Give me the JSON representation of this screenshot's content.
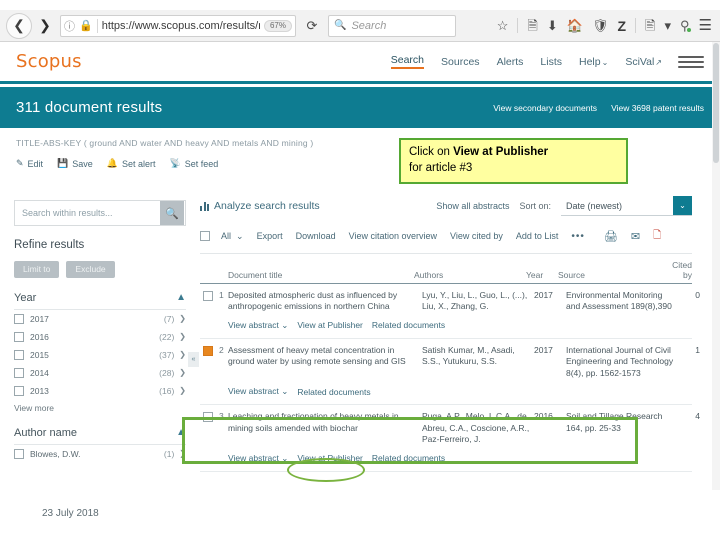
{
  "browser": {
    "back_icon": "back-arrow-icon",
    "forward_icon": "forward-arrow-icon",
    "info_icon": "ⓘ",
    "lock_icon": "🔒",
    "url": "https://www.scopus.com/results/r",
    "zoom_level": "67%",
    "reload_icon": "⟳",
    "search_placeholder": "Search",
    "search_icon": "🔍",
    "toolbar_icons": [
      "bookmark-star",
      "reader-list",
      "downloads",
      "home",
      "shield",
      "zotero-Z",
      "page-capture",
      "dropdown-caret",
      "tracker",
      "menu"
    ]
  },
  "scopus": {
    "logo": "Scopus",
    "nav": [
      {
        "label": "Search",
        "active": true
      },
      {
        "label": "Sources",
        "active": false
      },
      {
        "label": "Alerts",
        "active": false
      },
      {
        "label": "Lists",
        "active": false
      },
      {
        "label": "Help",
        "caret": "⌄",
        "active": false
      },
      {
        "label": "SciVal",
        "caret": "↗",
        "active": false
      }
    ],
    "banner": {
      "results_title": "311 document results",
      "secondary_link": "View secondary documents",
      "patent_link": "View 3698 patent results",
      "bg_color": "#0e7c91"
    },
    "query": {
      "text": "TITLE-ABS-KEY ( ground  AND water  AND  heavy  AND metals  AND mining )",
      "actions": [
        {
          "label": "Edit",
          "icon": "pencil-icon"
        },
        {
          "label": "Save",
          "icon": "disk-icon"
        },
        {
          "label": "Set alert",
          "icon": "bell-icon"
        },
        {
          "label": "Set feed",
          "icon": "rss-icon"
        }
      ]
    }
  },
  "callout": {
    "line1_prefix": "Click on ",
    "line1_bold": "View at Publisher",
    "line2": "for article #3",
    "bg_color": "#ffffa0",
    "border_color": "#55a833"
  },
  "sidebar": {
    "search_within_placeholder": "Search within results...",
    "search_icon": "🔍",
    "refine_title": "Refine results",
    "limit_button": "Limit to",
    "exclude_button": "Exclude",
    "collapse_icon": "«",
    "facets": [
      {
        "title": "Year",
        "chevron": "⌃",
        "rows": [
          {
            "label": "2017",
            "count": "(7)"
          },
          {
            "label": "2016",
            "count": "(22)"
          },
          {
            "label": "2015",
            "count": "(37)"
          },
          {
            "label": "2014",
            "count": "(28)"
          },
          {
            "label": "2013",
            "count": "(16)"
          }
        ],
        "view_more": "View more"
      },
      {
        "title": "Author name",
        "chevron": "⌃",
        "rows": [
          {
            "label": "Blowes, D.W.",
            "count": "(1)"
          }
        ],
        "view_more": ""
      }
    ]
  },
  "results": {
    "analyze_label": "Analyze search results",
    "show_abstracts": "Show all abstracts",
    "sort_label": "Sort on:",
    "sort_value": "Date (newest)",
    "sort_caret": "⌄",
    "actions": {
      "all_label": "All",
      "all_caret": "⌄",
      "export": "Export",
      "download": "Download",
      "citation_overview": "View citation overview",
      "cited_by": "View cited by",
      "add_to_list": "Add to List",
      "more": "•••",
      "print_icon": "🖨",
      "mail_icon": "✉",
      "pdf_icon": "PDF"
    },
    "columns": {
      "title": "Document title",
      "authors": "Authors",
      "year": "Year",
      "source": "Source",
      "cited_by": "Cited by"
    },
    "rows": [
      {
        "index": "1",
        "checked": false,
        "title": "Deposited atmospheric dust as influenced by anthropogenic emissions in northern China",
        "authors": "Lyu, Y., Liu, L., Guo, L., (...), Liu, X., Zhang, G.",
        "year": "2017",
        "source": "Environmental Monitoring and Assessment 189(8),390",
        "cited_by": "0",
        "links": [
          "View abstract ⌄",
          "View at Publisher",
          "Related documents"
        ]
      },
      {
        "index": "2",
        "checked": true,
        "title": "Assessment of heavy metal concentration in ground water by using remote sensing and GIS",
        "authors": "Satish Kumar, M., Asadi, S.S., Yutukuru, S.S.",
        "year": "2017",
        "source": "International Journal of Civil Engineering and Technology 8(4), pp. 1562-1573",
        "cited_by": "1",
        "links": [
          "View abstract ⌄",
          "Related documents"
        ]
      },
      {
        "index": "3",
        "checked": false,
        "title": "Leaching and fractionation of heavy metals in mining soils amended with biochar",
        "authors": "Puga, A.P., Melo, L.C.A., de Abreu, C.A., Coscione, A.R., Paz-Ferreiro, J.",
        "year": "2016",
        "source": "Soil and Tillage Research 164, pp. 25-33",
        "cited_by": "4",
        "links": [
          "View abstract ⌄",
          "View at Publisher",
          "Related documents"
        ]
      }
    ]
  },
  "footer": {
    "date": "23 July 2018"
  }
}
